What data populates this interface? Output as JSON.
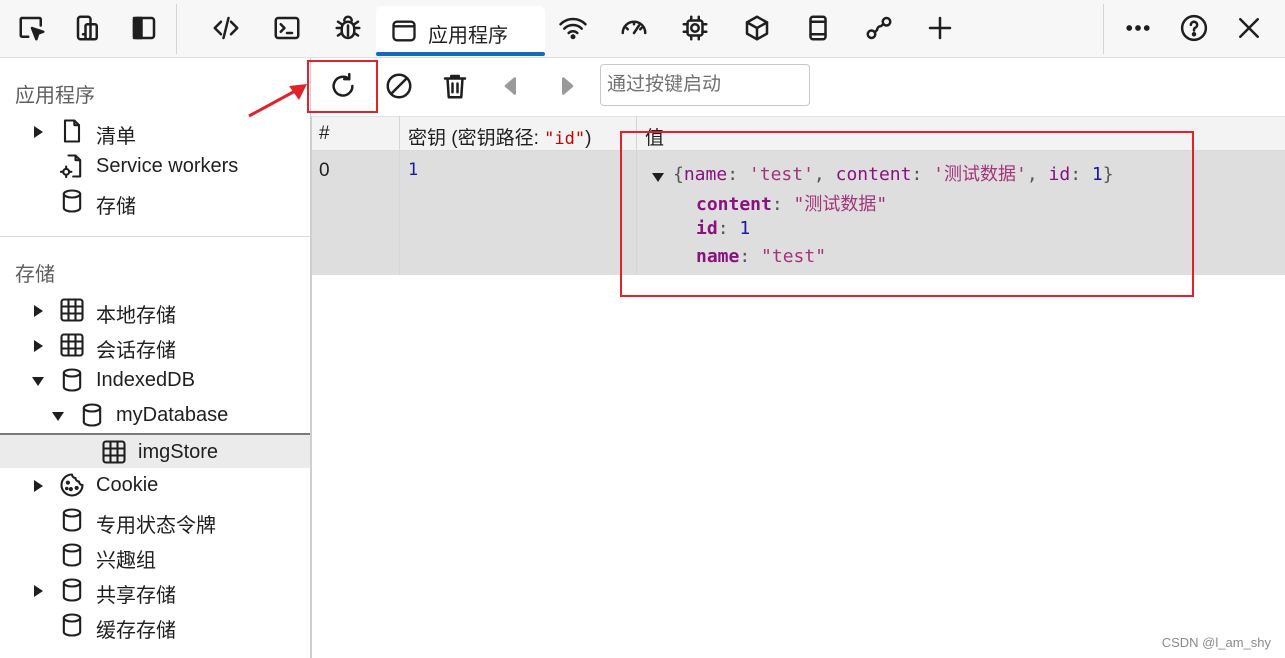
{
  "topbar": {
    "icons": [
      "inspect-icon",
      "device-emulation-icon",
      "sidebar-toggle-icon",
      "elements-icon",
      "console-icon",
      "sources-debug-icon",
      "network-icon",
      "performance-icon",
      "memory-icon",
      "3d-view-icon",
      "lighthouse-icon",
      "connections-icon",
      "add-tool-icon",
      "more-icon",
      "help-icon",
      "close-icon"
    ],
    "active_tab": "应用程序"
  },
  "sidebar": {
    "app_section": {
      "title": "应用程序",
      "items": [
        {
          "label": "清单",
          "icon": "file-icon",
          "expandable": true
        },
        {
          "label": "Service workers",
          "icon": "gear-file-icon",
          "expandable": false
        },
        {
          "label": "存储",
          "icon": "database-icon",
          "expandable": false
        }
      ]
    },
    "storage_section": {
      "title": "存储",
      "items": [
        {
          "label": "本地存储",
          "icon": "table-icon",
          "expandable": true
        },
        {
          "label": "会话存储",
          "icon": "table-icon",
          "expandable": true
        },
        {
          "label": "IndexedDB",
          "icon": "database-icon",
          "expanded": true
        },
        {
          "label": "myDatabase",
          "icon": "database-icon",
          "expanded": true
        },
        {
          "label": "imgStore",
          "icon": "table-icon",
          "selected": true
        },
        {
          "label": "Cookie",
          "icon": "cookie-icon",
          "expandable": true
        },
        {
          "label": "专用状态令牌",
          "icon": "database-icon"
        },
        {
          "label": "兴趣组",
          "icon": "database-icon"
        },
        {
          "label": "共享存储",
          "icon": "database-icon",
          "expandable": true
        },
        {
          "label": "缓存存储",
          "icon": "database-icon"
        }
      ]
    }
  },
  "toolbar": {
    "buttons": [
      "refresh-icon",
      "clear-icon",
      "delete-icon",
      "previous-page-icon",
      "next-page-icon"
    ],
    "filter_placeholder": "通过按键启动"
  },
  "table": {
    "headers": {
      "index": "#",
      "key_prefix": "密钥 (密钥路径: ",
      "key_path": "\"id\"",
      "key_suffix": ")",
      "value": "值"
    },
    "row": {
      "index": "0",
      "key": "1",
      "summary": {
        "name_key": "name",
        "name_val": "'test'",
        "content_key": "content",
        "content_val": "'测试数据'",
        "id_key": "id",
        "id_val": "1"
      },
      "props": [
        {
          "key": "content",
          "value": "\"测试数据\"",
          "type": "string"
        },
        {
          "key": "id",
          "value": "1",
          "type": "number"
        },
        {
          "key": "name",
          "value": "\"test\"",
          "type": "string"
        }
      ]
    }
  },
  "colors": {
    "accent": "#0f6cbd",
    "annotation": "#e2222b",
    "row_bg": "#dedede"
  },
  "watermark": "CSDN @l_am_shy"
}
